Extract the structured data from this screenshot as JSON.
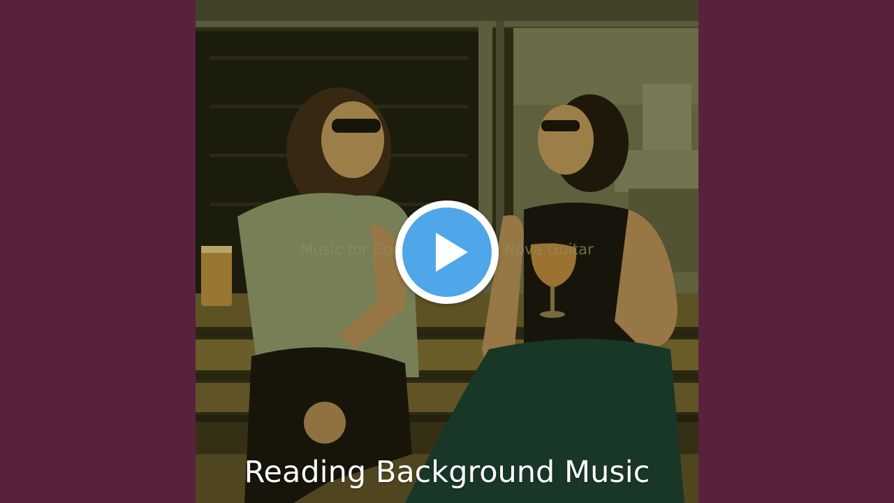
{
  "video": {
    "overlay_title": "Music for Cocktails - Bossa Nova Guitar",
    "caption": "Reading Background Music",
    "play_icon": "play-icon"
  },
  "colors": {
    "side_background": "#5a213f",
    "play_accent": "#4fa6e8",
    "caption_text": "#ffffff"
  }
}
